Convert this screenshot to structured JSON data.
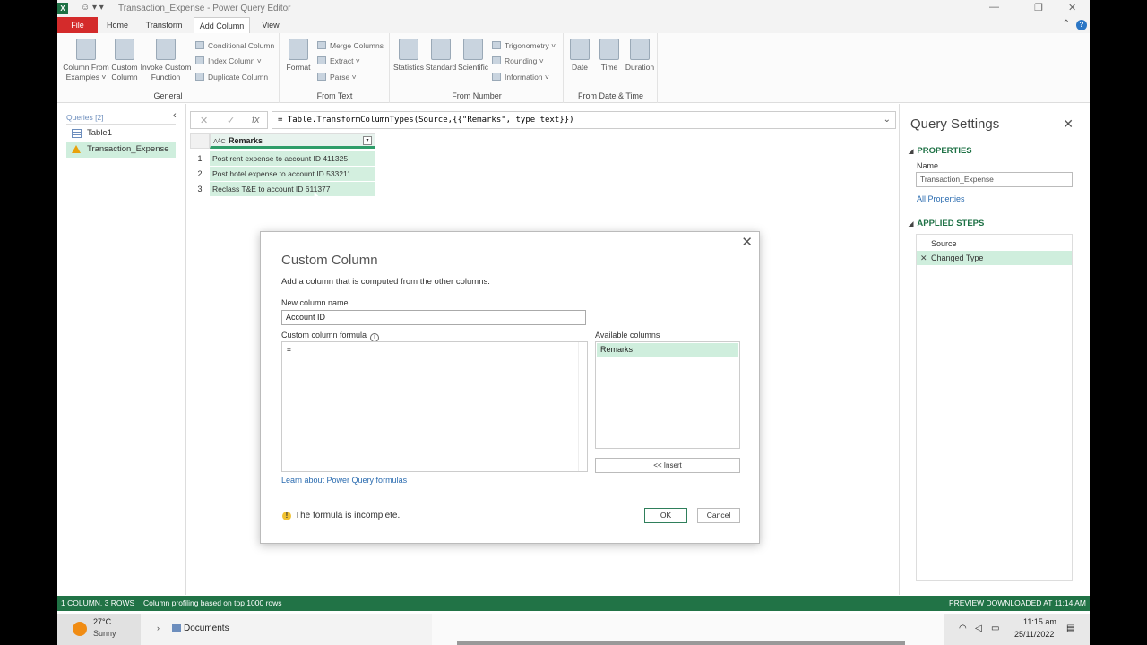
{
  "titlebar": {
    "app_icon": "excel-icon",
    "title": "Transaction_Expense - Power Query Editor"
  },
  "tabs": [
    {
      "label": "File"
    },
    {
      "label": "Home"
    },
    {
      "label": "Transform"
    },
    {
      "label": "Add Column"
    },
    {
      "label": "View"
    }
  ],
  "ribbon": {
    "general": {
      "label": "General",
      "column_from_examples": [
        "Column From",
        "Examples ˅"
      ],
      "custom_column": [
        "Custom",
        "Column"
      ],
      "invoke_custom_function": [
        "Invoke Custom",
        "Function"
      ],
      "conditional_column": "Conditional Column",
      "index_column": "Index Column ˅",
      "duplicate_column": "Duplicate Column"
    },
    "from_text": {
      "label": "From Text",
      "format": "Format",
      "merge_columns": "Merge Columns",
      "extract": "Extract ˅",
      "parse": "Parse ˅"
    },
    "from_number": {
      "label": "From Number",
      "statistics": "Statistics",
      "standard": "Standard",
      "scientific": "Scientific",
      "trigonometry": "Trigonometry ˅",
      "rounding": "Rounding ˅",
      "information": "Information ˅"
    },
    "from_date_time": {
      "label": "From Date & Time",
      "date": "Date",
      "time": "Time",
      "duration": "Duration"
    }
  },
  "queries": {
    "header": "Queries [2]",
    "items": [
      {
        "label": "Table1",
        "icon": "table-icon"
      },
      {
        "label": "Transaction_Expense",
        "icon": "warning-icon"
      }
    ]
  },
  "formula_bar": {
    "formula": "= Table.TransformColumnTypes(Source,{{\"Remarks\", type text}})"
  },
  "grid": {
    "column_header": "Remarks",
    "type_icon": "AᴬC",
    "rows": [
      {
        "n": "1",
        "value": "Post rent expense to account ID 411325"
      },
      {
        "n": "2",
        "value": "Post hotel expense to account ID 533211"
      },
      {
        "n": "3",
        "value": "Reclass T&E to account ID 611377"
      }
    ]
  },
  "query_settings": {
    "title": "Query Settings",
    "properties_header": "PROPERTIES",
    "name_label": "Name",
    "name_value": "Transaction_Expense",
    "all_properties": "All Properties",
    "applied_steps_header": "APPLIED STEPS",
    "steps": [
      "Source",
      "Changed Type"
    ]
  },
  "dialog": {
    "title": "Custom Column",
    "subtitle": "Add a column that is computed from the other columns.",
    "name_label": "New column name",
    "name_value": "Account ID",
    "formula_label": "Custom column formula",
    "formula_value": "=",
    "available_label": "Available columns",
    "available_items": [
      "Remarks"
    ],
    "insert_button": "<< Insert",
    "learn_link": "Learn about Power Query formulas",
    "warning": "The formula is incomplete.",
    "ok": "OK",
    "cancel": "Cancel"
  },
  "statusbar": {
    "left": "1 COLUMN, 3 ROWS",
    "middle": "Column profiling based on top 1000 rows",
    "right": "PREVIEW DOWNLOADED AT 11:14 AM"
  },
  "taskbar": {
    "temp": "27°C",
    "condition": "Sunny",
    "explorer_item": "Documents",
    "time": "11:15 am",
    "date": "25/11/2022"
  },
  "colors": {
    "accent_green": "#217346",
    "selection_green": "#cfeedd",
    "file_tab_red": "#d42b2b"
  }
}
